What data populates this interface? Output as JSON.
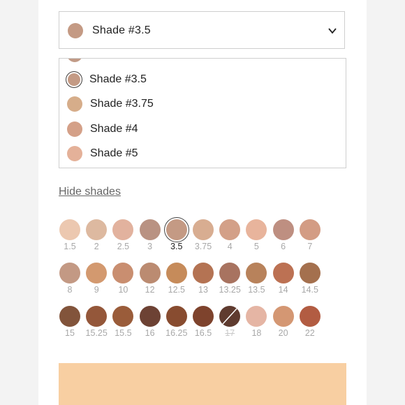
{
  "colors": {
    "selected_swatch": "#c49a84",
    "preview_bar": "#f8cfa2",
    "product_swipe": "#f8cfa2"
  },
  "select": {
    "label": "Shade  #3.5",
    "icon": "chevron-down-icon"
  },
  "dropdown": {
    "items": [
      {
        "label": "",
        "color": "#c19a86"
      },
      {
        "label": "Shade #3.5",
        "color": "#c49a84",
        "selected": true
      },
      {
        "label": "Shade #3.75",
        "color": "#d6ad8a"
      },
      {
        "label": "Shade #4",
        "color": "#d4a088"
      },
      {
        "label": "Shade #5",
        "color": "#e4b199"
      }
    ]
  },
  "hide_shades_label": "Hide shades",
  "shades": [
    {
      "label": "1.5",
      "color": "#ecc8b0"
    },
    {
      "label": "2",
      "color": "#ddb9a0"
    },
    {
      "label": "2.5",
      "color": "#e2b29e"
    },
    {
      "label": "3",
      "color": "#b99282"
    },
    {
      "label": "3.5",
      "color": "#c49a84",
      "selected": true
    },
    {
      "label": "3.75",
      "color": "#d8ad91"
    },
    {
      "label": "4",
      "color": "#d3a088"
    },
    {
      "label": "5",
      "color": "#e8b49c"
    },
    {
      "label": "6",
      "color": "#be8f81"
    },
    {
      "label": "7",
      "color": "#d39c84"
    },
    {
      "label": "8",
      "color": "#c39984"
    },
    {
      "label": "9",
      "color": "#d3996f"
    },
    {
      "label": "10",
      "color": "#c98e70"
    },
    {
      "label": "12",
      "color": "#bb8b71"
    },
    {
      "label": "12.5",
      "color": "#c68b5a"
    },
    {
      "label": "13",
      "color": "#b47353"
    },
    {
      "label": "13.25",
      "color": "#a87360"
    },
    {
      "label": "13.5",
      "color": "#b8825b"
    },
    {
      "label": "14",
      "color": "#bc7153"
    },
    {
      "label": "14.5",
      "color": "#a4704e"
    },
    {
      "label": "15",
      "color": "#82543b"
    },
    {
      "label": "15.25",
      "color": "#94573a"
    },
    {
      "label": "15.5",
      "color": "#9a5c3a"
    },
    {
      "label": "16",
      "color": "#6d4234"
    },
    {
      "label": "16.25",
      "color": "#884c30"
    },
    {
      "label": "16.5",
      "color": "#7e432d"
    },
    {
      "label": "17",
      "color": "#5f3b2f",
      "unavailable": true
    },
    {
      "label": "18",
      "color": "#e5b5a4"
    },
    {
      "label": "20",
      "color": "#d49773"
    },
    {
      "label": "22",
      "color": "#b25c42"
    }
  ]
}
